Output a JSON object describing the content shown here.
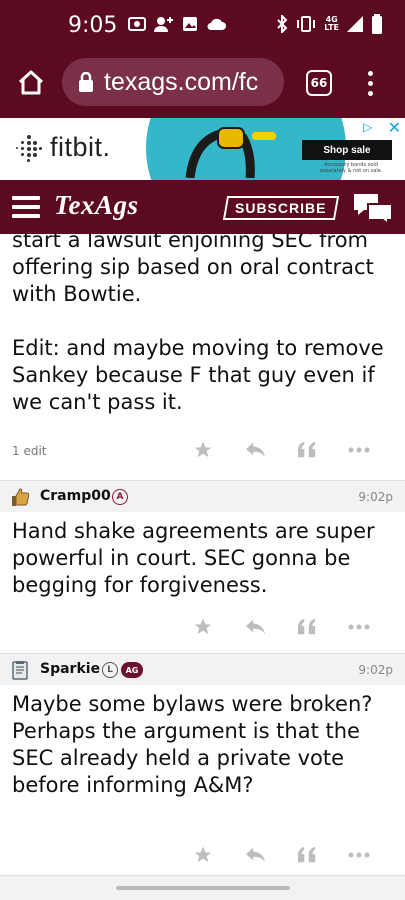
{
  "status_bar": {
    "time": "9:05",
    "network": "4G\nLTE"
  },
  "browser": {
    "url": "texags.com/fc",
    "tab_count": "66"
  },
  "ad": {
    "brand": "fitbit.",
    "cta": "Shop sale",
    "disclaimer": "Accessory bands sold separately & not on sale."
  },
  "site_header": {
    "logo": "TexAgs",
    "subscribe_label": "SUBSCRIBE"
  },
  "posts": [
    {
      "body_lines": [
        "start a lawsuit enjoining SEC from offering sip based on oral contract with Bowtie.",
        "",
        "Edit: and maybe moving to remove Sankey because F that guy even if we can't pass it."
      ],
      "edit_note": "1 edit"
    },
    {
      "username": "Cramp00",
      "badges": [
        "A"
      ],
      "time": "9:02p",
      "body": "Hand shake agreements are super powerful in court. SEC gonna be begging for forgiveness."
    },
    {
      "username": "Sparkie",
      "badges": [
        "L",
        "AG"
      ],
      "time": "9:02p",
      "body": "Maybe some bylaws were broken? Perhaps the argument is that the SEC already held a private vote before informing A&M?"
    }
  ],
  "colors": {
    "maroon": "#5c0a22",
    "header_gray": "#f2f2f2",
    "action_gray": "#bdbdbd"
  }
}
